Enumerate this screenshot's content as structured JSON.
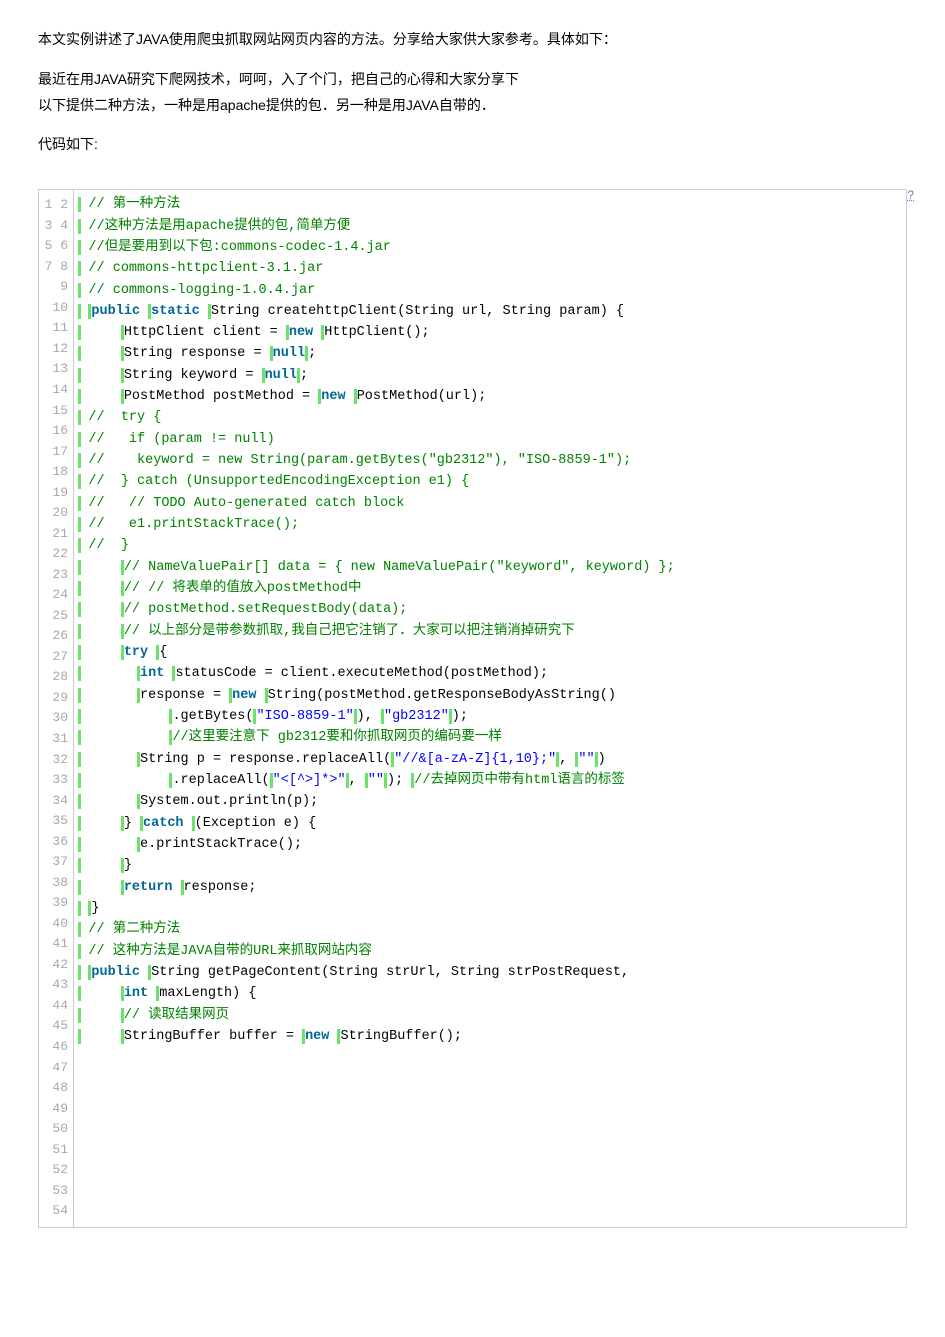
{
  "intro": {
    "p1": "本文实例讲述了JAVA使用爬虫抓取网站网页内容的方法。分享给大家供大家参考。具体如下：",
    "p2": "最近在用JAVA研究下爬网技术，呵呵，入了个门，把自己的心得和大家分享下",
    "p3": "以下提供二种方法，一种是用apache提供的包．另一种是用JAVA自带的．",
    "p4": "代码如下:"
  },
  "qmark": "?",
  "gutter_lines": 54,
  "code": {
    "l1": {
      "cm": "// 第一种方法"
    },
    "l2": {
      "cm": "//这种方法是用apache提供的包,简单方便"
    },
    "l3": {
      "cm": "//但是要用到以下包:commons-codec-1.4.jar"
    },
    "l4": {
      "cm": "// commons-httpclient-3.1.jar"
    },
    "l5": {
      "cm": "// commons-logging-1.0.4.jar"
    },
    "l6": {
      "k1": "public",
      "k2": "static",
      "rest": "String createhttpClient(String url, String param) {"
    },
    "l7": {
      "pre": "    ",
      "body": "HttpClient client = ",
      "k": "new",
      "rest": "HttpClient();"
    },
    "l8": {
      "pre": "    ",
      "body": "String response = ",
      "k": "null",
      "rest": ";"
    },
    "l9": {
      "pre": "    ",
      "body": "String keyword = ",
      "k": "null",
      "rest": ";"
    },
    "l10": {
      "pre": "    ",
      "body": "PostMethod postMethod = ",
      "k": "new",
      "rest": "PostMethod(url);"
    },
    "l11": {
      "cm": "//  try {"
    },
    "l12": {
      "cm": "//   if (param != null)"
    },
    "l13": {
      "cm": "//    keyword = new String(param.getBytes(\"gb2312\"), \"ISO-8859-1\");"
    },
    "l14": {
      "cm": "//  } catch (UnsupportedEncodingException e1) {"
    },
    "l15": {
      "cm": "//   // TODO Auto-generated catch block"
    },
    "l16": {
      "cm": "//   e1.printStackTrace();"
    },
    "l17": {
      "cm": "//  }"
    },
    "l18": {
      "pre": "    ",
      "cm": "// NameValuePair[] data = { new NameValuePair(\"keyword\", keyword) };"
    },
    "l19": {
      "pre": "    ",
      "cm": "// // 将表单的值放入postMethod中"
    },
    "l20": {
      "pre": "    ",
      "cm": "// postMethod.setRequestBody(data);"
    },
    "l21": {
      "pre": "    ",
      "cm": "// 以上部分是带参数抓取,我自己把它注销了．大家可以把注销消掉研究下"
    },
    "l22": {
      "pre": "    ",
      "k": "try",
      "rest": "{"
    },
    "l23": {
      "pre": "      ",
      "k": "int",
      "rest": "statusCode = client.executeMethod(postMethod);"
    },
    "l24": {
      "pre": "      ",
      "body": "response = ",
      "k": "new",
      "rest": "String(postMethod.getResponseBodyAsString()"
    },
    "l25": {
      "pre": "          ",
      "body": ".getBytes(",
      "s1": "\"ISO-8859-1\"",
      "mid": "), ",
      "s2": "\"gb2312\"",
      "rest": ");"
    },
    "l26": {
      "pre": "          ",
      "cm": "//这里要注意下 gb2312要和你抓取网页的编码要一样"
    },
    "l27": {
      "pre": "      ",
      "body": "String p = response.replaceAll(",
      "s1": "\"//&[a-zA-Z]{1,10};\"",
      "mid": ", ",
      "s2": "\"\"",
      "rest": ")"
    },
    "l28": {
      "pre": "          ",
      "body": ".replaceAll(",
      "s1": "\"<[^>]*>\"",
      "mid": ", ",
      "s2": "\"\"",
      "tail": "); ",
      "cm": "//去掉网页中带有html语言的标签"
    },
    "l29": {
      "pre": "      ",
      "body": "System.out.println(p);"
    },
    "l30": {
      "pre": "    ",
      "body": "} ",
      "k": "catch",
      "rest": "(Exception e) {"
    },
    "l31": {
      "pre": "      ",
      "body": "e.printStackTrace();"
    },
    "l32": {
      "pre": "    ",
      "body": "}"
    },
    "l33": {
      "pre": "    ",
      "k": "return",
      "rest": "response;"
    },
    "l34": {
      "body": "}"
    },
    "l35": {
      "cm": "// 第二种方法"
    },
    "l36": {
      "cm": "// 这种方法是JAVA自带的URL来抓取网站内容"
    },
    "l37": {
      "k": "public",
      "rest": "String getPageContent(String strUrl, String strPostRequest,"
    },
    "l38": {
      "pre": "    ",
      "k": "int",
      "rest": "maxLength) {"
    },
    "l39": {
      "pre": "    ",
      "cm": "// 读取结果网页"
    },
    "l40": {
      "pre": "    ",
      "body": "StringBuffer buffer = ",
      "k": "new",
      "rest": "StringBuffer();"
    }
  }
}
